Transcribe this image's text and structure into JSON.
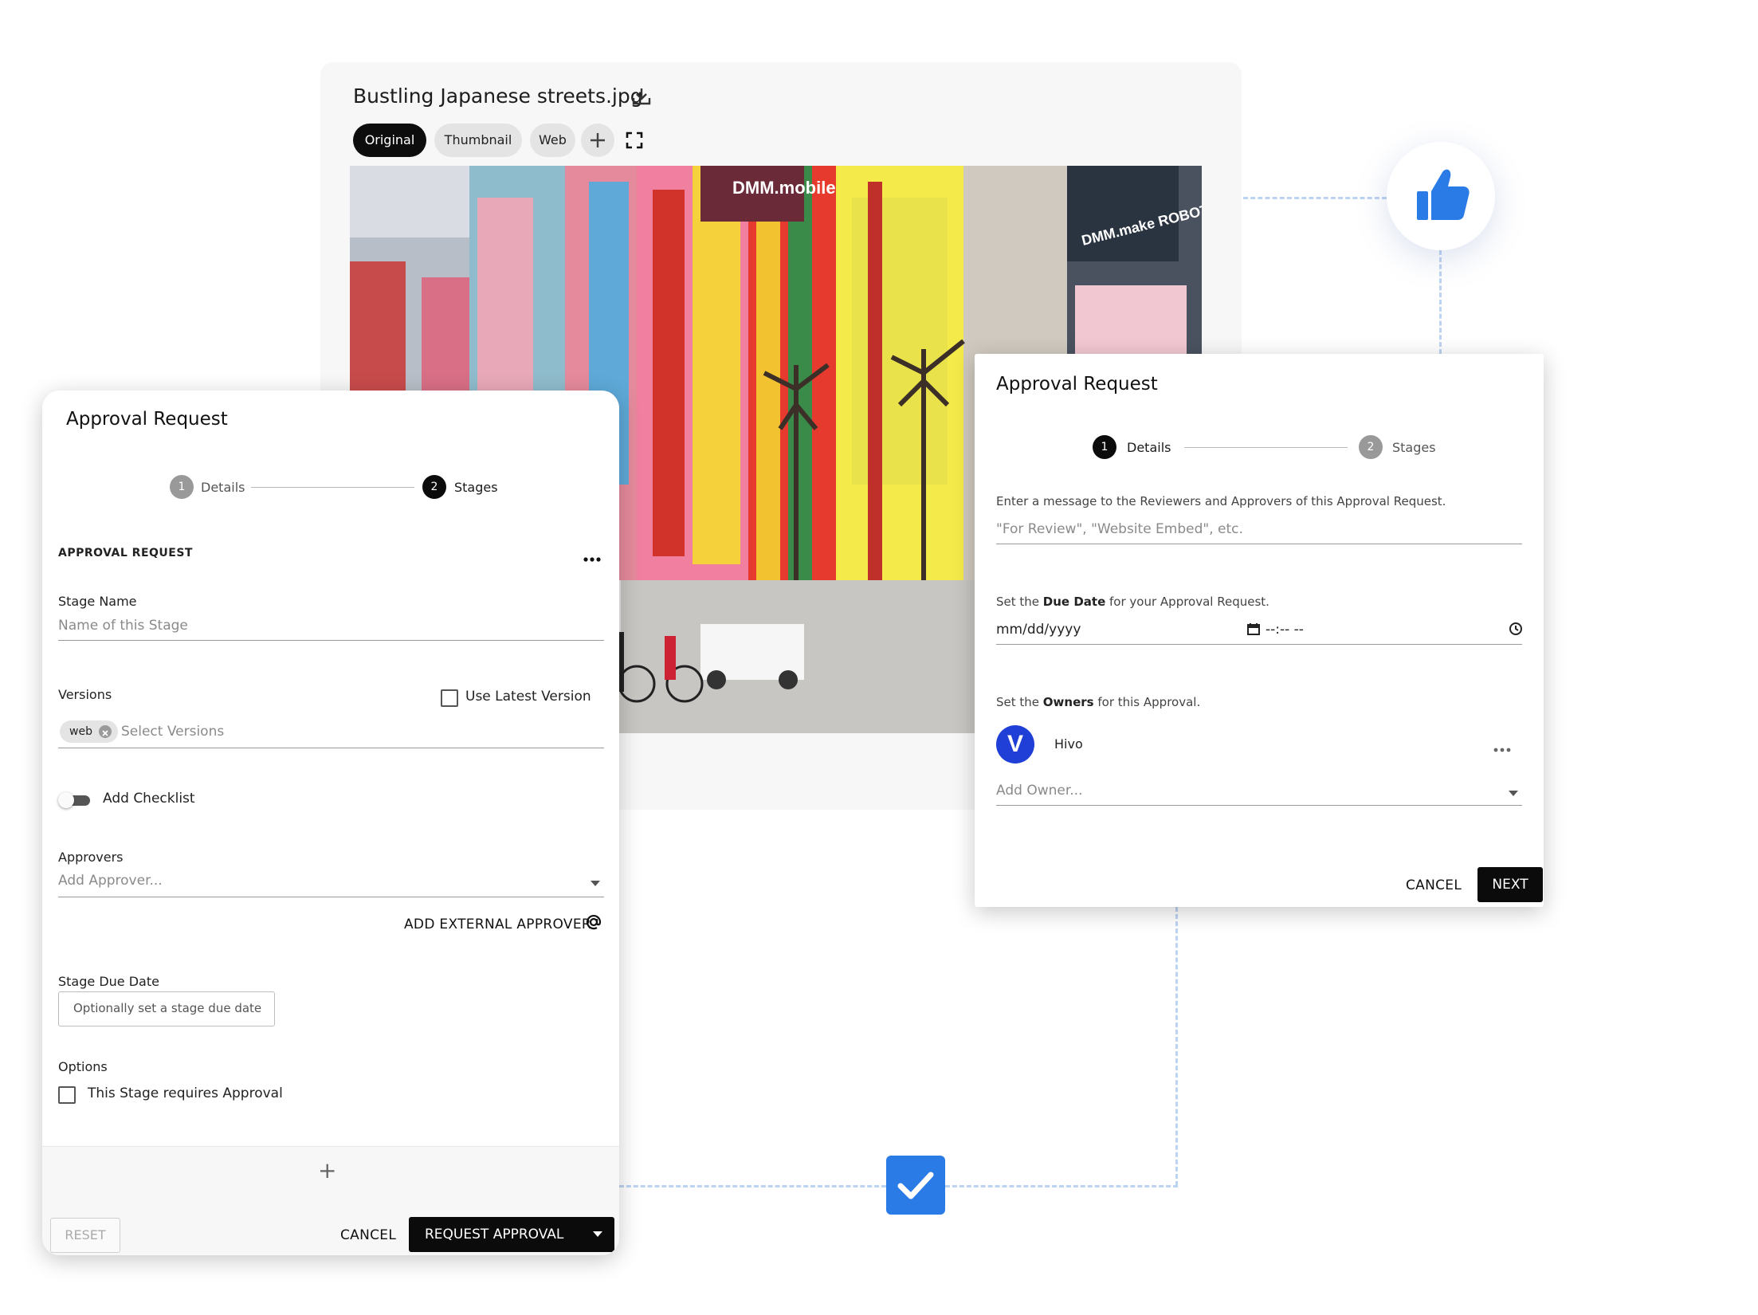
{
  "asset": {
    "filename": "Bustling Japanese streets.jpg",
    "tabs": [
      {
        "label": "Original",
        "active": true
      },
      {
        "label": "Thumbnail",
        "active": false
      },
      {
        "label": "Web",
        "active": false
      }
    ]
  },
  "photo_signs": {
    "dmm_mobile": "DMM.mobile",
    "dmm_robots": "DMM.make ROBOTS"
  },
  "left_dialog": {
    "title": "Approval Request",
    "steps": [
      {
        "num": "1",
        "label": "Details",
        "active": false
      },
      {
        "num": "2",
        "label": "Stages",
        "active": true
      }
    ],
    "section_heading": "APPROVAL REQUEST",
    "stage_name": {
      "label": "Stage Name",
      "placeholder": "Name of this Stage"
    },
    "versions": {
      "label": "Versions",
      "use_latest": "Use Latest Version",
      "chip": "web",
      "placeholder": "Select Versions"
    },
    "checklist": {
      "label": "Add Checklist",
      "enabled": false
    },
    "approvers": {
      "label": "Approvers",
      "placeholder": "Add Approver..."
    },
    "add_external": "ADD EXTERNAL APPROVER",
    "due_date": {
      "label": "Stage Due Date",
      "placeholder": "Optionally set a stage due date"
    },
    "options": {
      "label": "Options",
      "requires_approval": "This Stage requires Approval"
    },
    "add_stage_symbol": "+",
    "buttons": {
      "reset": "RESET",
      "cancel": "CANCEL",
      "request": "REQUEST APPROVAL"
    }
  },
  "right_dialog": {
    "title": "Approval Request",
    "steps": [
      {
        "num": "1",
        "label": "Details",
        "active": true
      },
      {
        "num": "2",
        "label": "Stages",
        "active": false
      }
    ],
    "message": {
      "prompt": "Enter a message to the Reviewers and Approvers of this Approval Request.",
      "placeholder": "\"For Review\", \"Website Embed\", etc."
    },
    "due": {
      "prefix": "Set the ",
      "bold": "Due Date",
      "suffix": " for your Approval Request.",
      "date_placeholder": "mm/dd/yyyy",
      "time_placeholder": "--:-- --"
    },
    "owners": {
      "prefix": "Set the ",
      "bold": "Owners",
      "suffix": " for this Approval.",
      "owner_name": "Hivo",
      "owner_initial": "V",
      "placeholder": "Add Owner..."
    },
    "buttons": {
      "cancel": "CANCEL",
      "next": "NEXT"
    }
  },
  "colors": {
    "accent": "#2b7be6",
    "owner_avatar": "#1f3fd6",
    "dash": "#bcd3f2"
  },
  "icons": [
    "download-icon",
    "plus-icon",
    "expand-icon",
    "thumbs-up-icon",
    "checkmark-icon",
    "more-icon",
    "at-icon",
    "calendar-icon",
    "clock-icon",
    "dropdown-caret-icon",
    "close-chip-icon"
  ]
}
